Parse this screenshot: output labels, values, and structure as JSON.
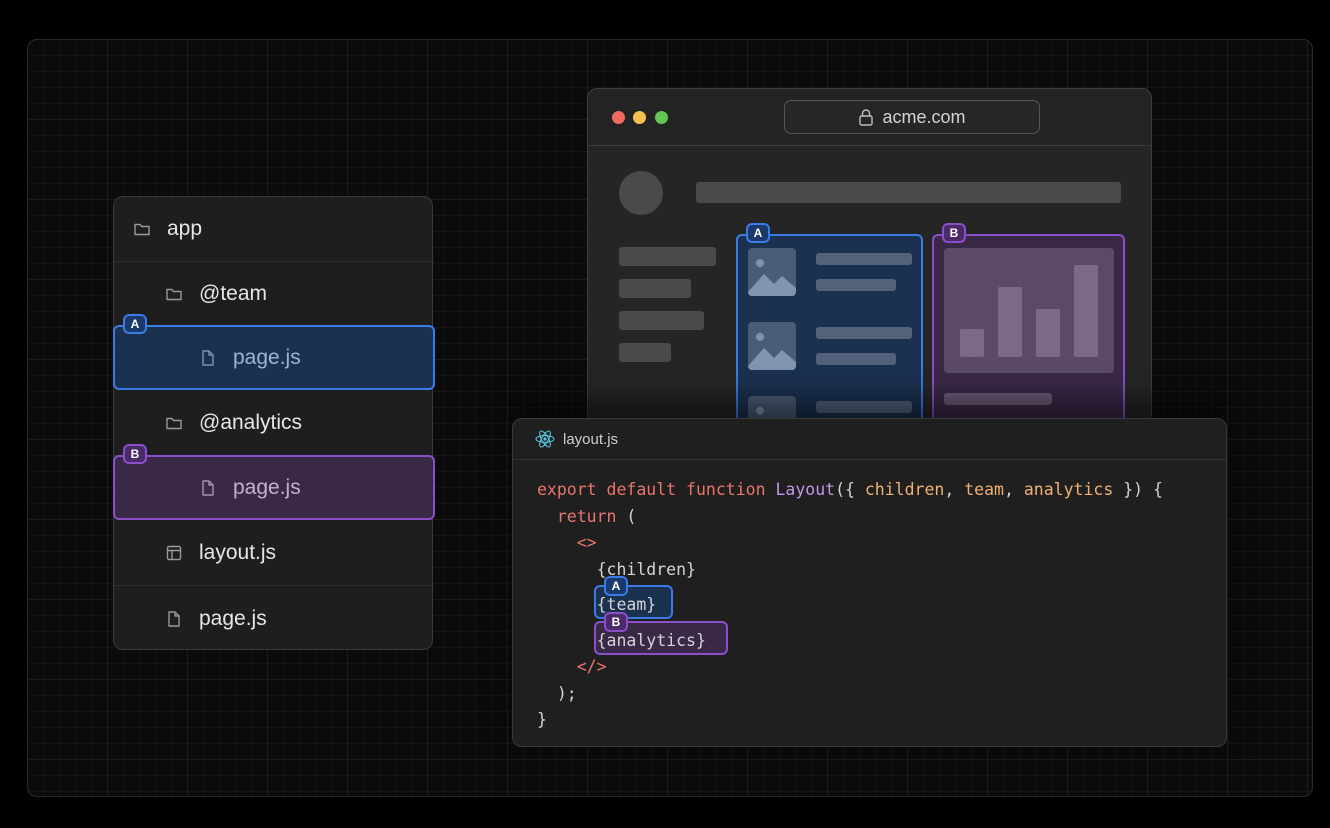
{
  "tree": {
    "items": [
      {
        "label": "app",
        "icon": "folder-icon"
      },
      {
        "label": "@team",
        "icon": "folder-icon"
      },
      {
        "label": "page.js",
        "icon": "file-icon",
        "slot": "A"
      },
      {
        "label": "@analytics",
        "icon": "folder-icon"
      },
      {
        "label": "page.js",
        "icon": "file-icon",
        "slot": "B"
      },
      {
        "label": "layout.js",
        "icon": "layout-icon"
      },
      {
        "label": "page.js",
        "icon": "file-icon"
      }
    ]
  },
  "slots": {
    "a": "A",
    "b": "B"
  },
  "browser": {
    "url": "acme.com"
  },
  "editor": {
    "filename": "layout.js",
    "code": {
      "l1_export": "export",
      "l1_default": "default",
      "l1_function": "function",
      "l1_name": "Layout",
      "l1_open": "({ ",
      "l1_children": "children",
      "l1_team": "team",
      "l1_analytics": "analytics",
      "l1_close": " }) {",
      "l2_return": "return",
      "l2_paren": " (",
      "l3_frag_open": "<>",
      "l4_children": "{children}",
      "l5_team": "{team}",
      "l6_analytics": "{analytics}",
      "l7_frag_close": "</>",
      "l8_end": ");",
      "l9_brace": "}"
    }
  },
  "colors": {
    "slot_a": "#3b7be6",
    "slot_b": "#8a4fc9",
    "traffic_red": "#ee6a5f",
    "traffic_yellow": "#f5be4f",
    "traffic_green": "#62c554"
  }
}
